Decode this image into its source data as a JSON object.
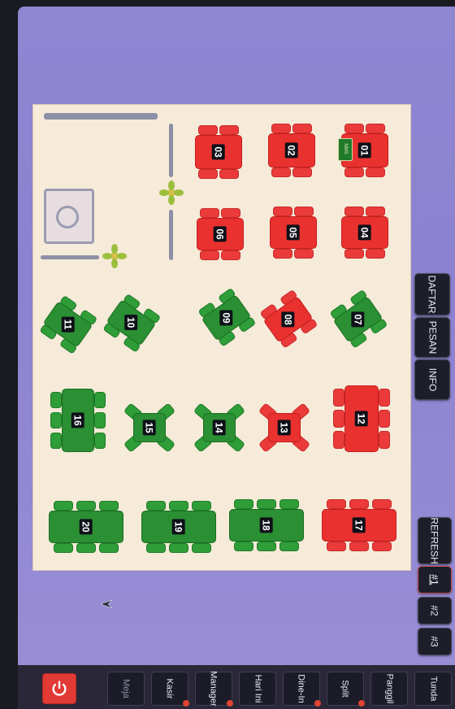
{
  "floor": {
    "tables": [
      {
        "label": "01",
        "status": "red",
        "type": "square"
      },
      {
        "label": "02",
        "status": "red",
        "type": "square"
      },
      {
        "label": "03",
        "status": "red",
        "type": "square"
      },
      {
        "label": "04",
        "status": "red",
        "type": "square"
      },
      {
        "label": "05",
        "status": "red",
        "type": "square"
      },
      {
        "label": "06",
        "status": "red",
        "type": "square"
      },
      {
        "label": "07",
        "status": "green",
        "type": "diagonal"
      },
      {
        "label": "08",
        "status": "red",
        "type": "diagonal"
      },
      {
        "label": "09",
        "status": "green",
        "type": "diagonal"
      },
      {
        "label": "10",
        "status": "green",
        "type": "diagonal"
      },
      {
        "label": "11",
        "status": "green",
        "type": "diagonal"
      },
      {
        "label": "12",
        "status": "red",
        "type": "long"
      },
      {
        "label": "13",
        "status": "red",
        "type": "cross"
      },
      {
        "label": "14",
        "status": "green",
        "type": "cross"
      },
      {
        "label": "15",
        "status": "green",
        "type": "cross"
      },
      {
        "label": "16",
        "status": "green",
        "type": "long"
      },
      {
        "label": "17",
        "status": "red",
        "type": "wide"
      },
      {
        "label": "18",
        "status": "green",
        "type": "wide"
      },
      {
        "label": "19",
        "status": "green",
        "type": "wide"
      },
      {
        "label": "20",
        "status": "green",
        "type": "wide"
      }
    ],
    "ticket_text": "NMS",
    "colors": {
      "occupied": "#e9312f",
      "available": "#2b8f33"
    }
  },
  "side": {
    "daftar": "DAFTAR",
    "pesan": "PESAN",
    "info": "INFO",
    "refresh": "REFRESH",
    "page1": "#1",
    "page2": "#2",
    "page3": "#3"
  },
  "taskbar": {
    "meja": "Meja",
    "kasir": "Kasir",
    "manager": "Manager",
    "hari_ini": "Hari Ini",
    "dine_in": "Dine-In",
    "split": "Split",
    "panggil": "Panggil",
    "tunda": "Tunda",
    "power_icon": "power-icon"
  }
}
